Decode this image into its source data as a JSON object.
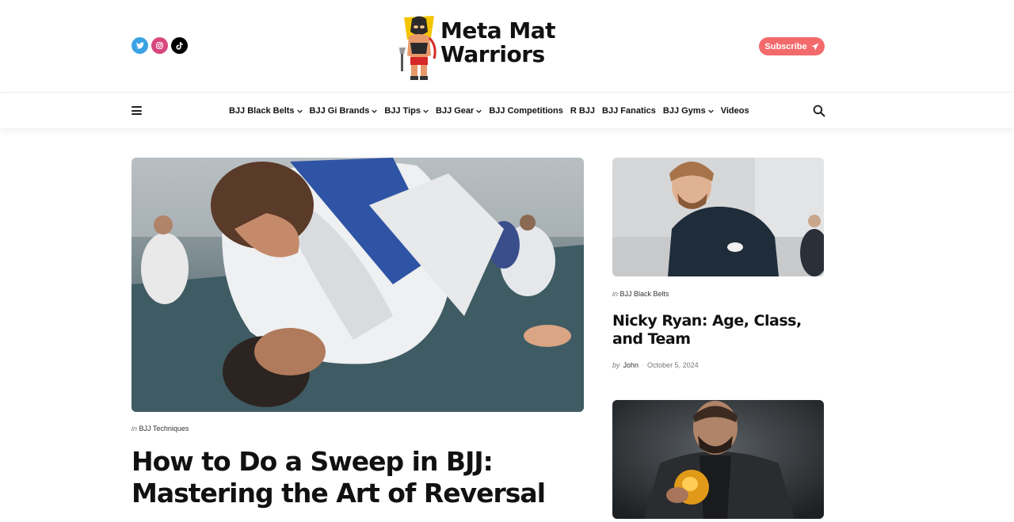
{
  "header": {
    "socials": [
      {
        "name": "twitter-icon",
        "glyph": "t"
      },
      {
        "name": "instagram-icon",
        "glyph": "◎"
      },
      {
        "name": "tiktok-icon",
        "glyph": "♪"
      }
    ],
    "logo_line1": "Meta Mat",
    "logo_line2": "Warriors",
    "subscribe_label": "Subscribe"
  },
  "nav": {
    "items": [
      {
        "label": "BJJ Black Belts",
        "dropdown": true
      },
      {
        "label": "BJJ Gi Brands",
        "dropdown": true
      },
      {
        "label": "BJJ Tips",
        "dropdown": true
      },
      {
        "label": "BJJ Gear",
        "dropdown": true
      },
      {
        "label": "BJJ Competitions",
        "dropdown": false
      },
      {
        "label": "R BJJ",
        "dropdown": false
      },
      {
        "label": "BJJ Fanatics",
        "dropdown": false
      },
      {
        "label": "BJJ Gyms",
        "dropdown": true
      },
      {
        "label": "Videos",
        "dropdown": false
      }
    ]
  },
  "feature": {
    "in_label": "in",
    "category": "BJJ Techniques",
    "title": "How to Do a Sweep in BJJ: Mastering the Art of Reversal"
  },
  "sidebar": {
    "post1": {
      "in_label": "in",
      "category": "BJJ Black Belts",
      "title": "Nicky Ryan: Age, Class, and Team",
      "by_label": "by",
      "author": "John",
      "separator": "·",
      "date": "October 5, 2024"
    }
  },
  "colors": {
    "accent": "#f36a6c",
    "twitter": "#3ba2e4",
    "instagram": "#d8477e",
    "tiktok": "#000000"
  }
}
